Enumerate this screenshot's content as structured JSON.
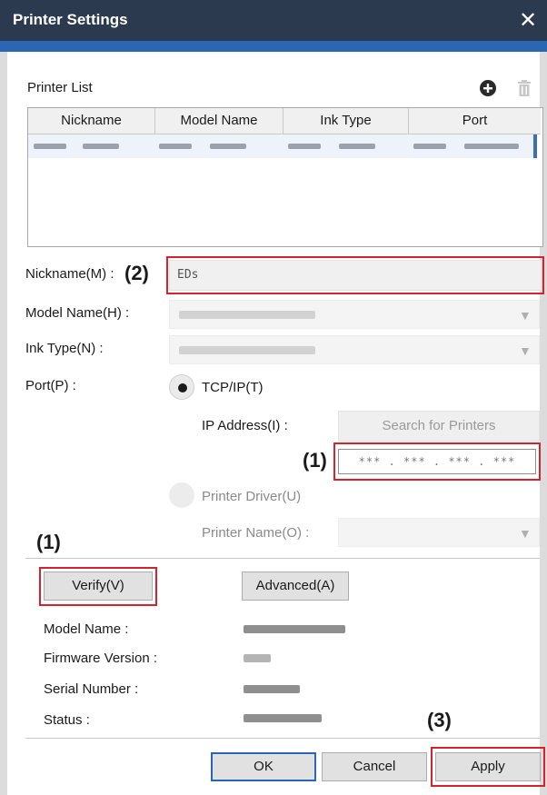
{
  "window": {
    "title": "Printer Settings",
    "close_glyph": "✕"
  },
  "printer_list": {
    "label": "Printer List",
    "add_icon": "plus-circle-icon",
    "delete_icon": "trash-icon",
    "columns": [
      "Nickname",
      "Model Name",
      "Ink Type",
      "Port"
    ]
  },
  "form": {
    "nickname_label": "Nickname(M) :",
    "nickname_value": "EDs",
    "model_label": "Model Name(H) :",
    "ink_label": "Ink Type(N) :",
    "port_label": "Port(P) :",
    "tcpip_label": "TCP/IP(T)",
    "ip_label": "IP Address(I) :",
    "ip_value": "*** . *** . *** . ***",
    "search_button": "Search for Printers",
    "driver_label": "Printer Driver(U)",
    "printer_name_label": "Printer Name(O) :",
    "chevron": "▼"
  },
  "verify": {
    "verify_button": "Verify(V)",
    "advanced_button": "Advanced(A)",
    "model_name_label": "Model Name :",
    "firmware_label": "Firmware Version :",
    "serial_label": "Serial Number :",
    "status_label": "Status :"
  },
  "footer": {
    "ok": "OK",
    "cancel": "Cancel",
    "apply": "Apply"
  },
  "callouts": {
    "one": "(1)",
    "two": "(2)",
    "three": "(3)"
  },
  "colors": {
    "titlebar": "#2b3a4e",
    "accent": "#2b66b2",
    "highlight": "#d6232b"
  }
}
